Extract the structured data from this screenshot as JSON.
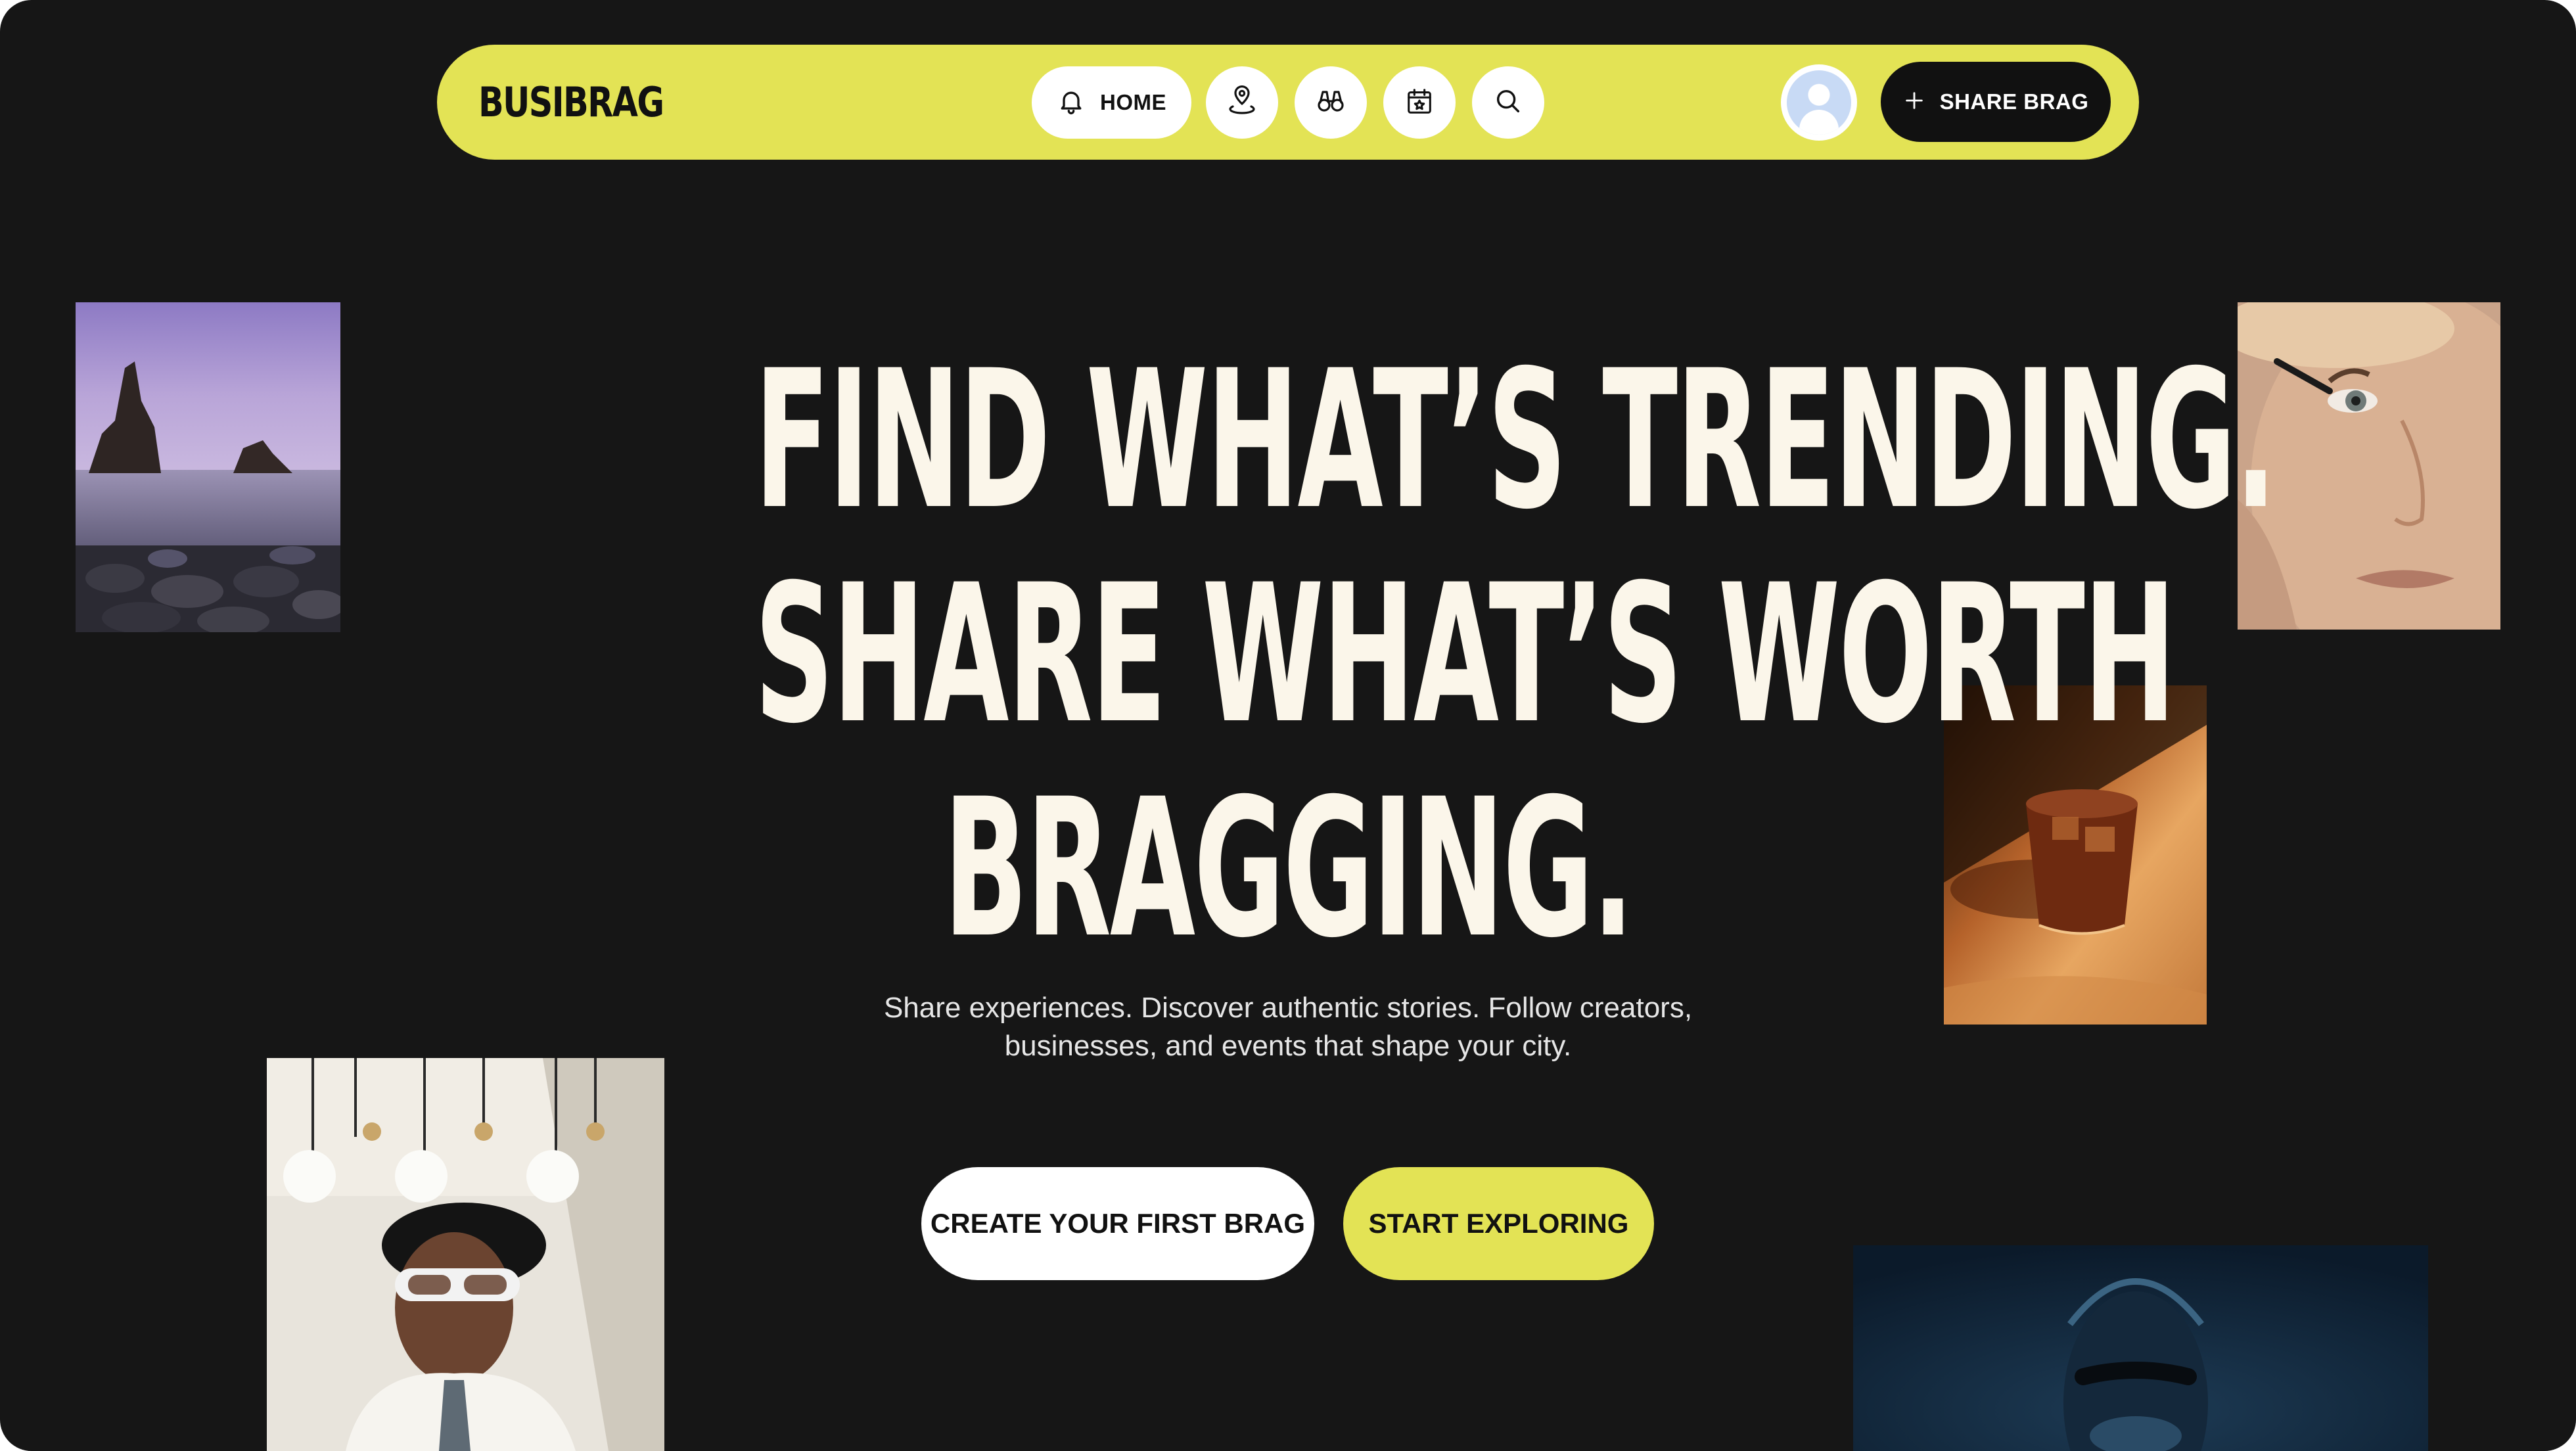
{
  "brand": {
    "logo": "BUSIBRAG",
    "accent": "#e3e355",
    "background": "#161616",
    "headline_color": "#fbf6ea"
  },
  "nav": {
    "home_label": "HOME",
    "icons": [
      "bell-icon",
      "location-pin-icon",
      "binoculars-icon",
      "calendar-star-icon",
      "search-icon"
    ],
    "share_label": "SHARE BRAG"
  },
  "hero": {
    "headline_lines": [
      "FIND WHAT’S TRENDING.",
      "SHARE WHAT’S WORTH",
      "BRAGGING."
    ],
    "subtitle_lines": [
      "Share experiences. Discover authentic stories. Follow creators,",
      "businesses, and events that shape your city."
    ],
    "cta_primary": "CREATE YOUR FIRST BRAG",
    "cta_secondary": "START EXPLORING"
  },
  "photos": [
    {
      "name": "photo-sea-rocks"
    },
    {
      "name": "photo-woman-mascara"
    },
    {
      "name": "photo-iced-drink"
    },
    {
      "name": "photo-woman-sunglasses"
    },
    {
      "name": "photo-woman-blue-light"
    }
  ]
}
